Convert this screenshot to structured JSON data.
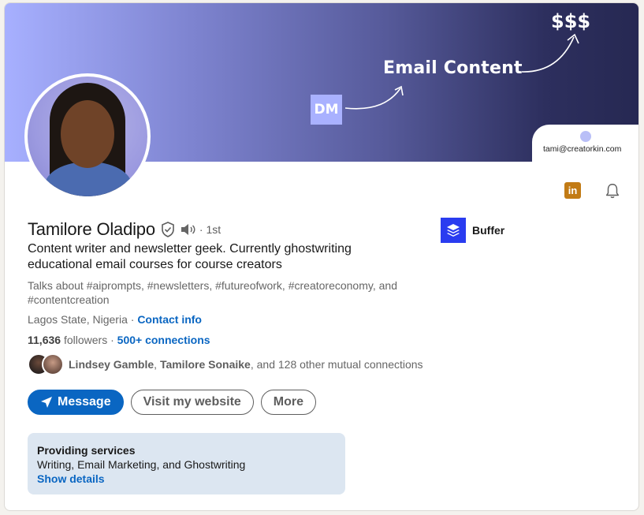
{
  "banner": {
    "headline": "Email Content",
    "money": "$$$",
    "dm_label": "DM",
    "email": "tami@creatorkin.com"
  },
  "profile": {
    "name": "Tamilore Oladipo",
    "degree": "· 1st",
    "headline": "Content writer and newsletter geek. Currently ghostwriting educational email courses for course creators",
    "talks_about": "Talks about #aiprompts, #newsletters, #futureofwork, #creatoreconomy, and #contentcreation",
    "location": "Lagos State, Nigeria",
    "location_sep": " · ",
    "contact_info": "Contact info",
    "followers_count": "11,636",
    "followers_label": " followers",
    "connections_sep": " · ",
    "connections": "500+ connections",
    "mutual_name_1": "Lindsey Gamble",
    "mutual_sep": ", ",
    "mutual_name_2": "Tamilore Sonaike",
    "mutual_rest": ", and 128 other mutual connections"
  },
  "actions": {
    "message": "Message",
    "website": "Visit my website",
    "more": "More",
    "linkedin_badge": "in"
  },
  "company": {
    "name": "Buffer"
  },
  "services": {
    "title": "Providing services",
    "list": "Writing, Email Marketing, and Ghostwriting",
    "link": "Show details"
  },
  "colors": {
    "primary": "#0a66c2",
    "services_bg": "#dce6f1",
    "linkedin_badge": "#c27b15",
    "buffer_logo": "#2a3cf0"
  },
  "icons": [
    "verified-shield-icon",
    "speaker-icon",
    "linkedin-icon",
    "bell-icon",
    "send-icon",
    "buffer-logo-icon"
  ]
}
